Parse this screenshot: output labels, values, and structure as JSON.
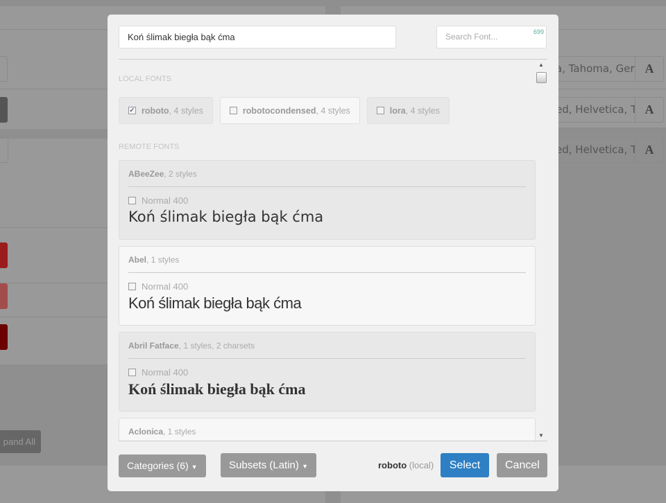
{
  "background": {
    "font_fields": [
      "a, Tahoma, Ger",
      "ed, Helvetica, Ta",
      "ed, Helvetica, Ta"
    ],
    "expand_all_label": "pand All",
    "swatch_colors": [
      "#9b1c1c",
      "#a24c4c",
      "#6a0000"
    ]
  },
  "modal": {
    "preview_text": "Koń ślimak biegła bąk ćma",
    "search_placeholder": "Search Font...",
    "font_count": "699",
    "local_heading": "LOCAL FONTS",
    "remote_heading": "REMOTE FONTS",
    "local_fonts": [
      {
        "name": "roboto",
        "styles": ", 4 styles",
        "checked": true
      },
      {
        "name": "robotocondensed",
        "styles": ", 4 styles",
        "checked": false
      },
      {
        "name": "lora",
        "styles": ", 4 styles",
        "checked": false
      }
    ],
    "remote_fonts": [
      {
        "name": "ABeeZee",
        "meta": ", 2 styles",
        "style": "Normal 400",
        "preview": "Koń ślimak biegła bąk ćma"
      },
      {
        "name": "Abel",
        "meta": ", 1 styles",
        "style": "Normal 400",
        "preview": "Koń ślimak biegła bąk ćma"
      },
      {
        "name": "Abril Fatface",
        "meta": ", 1 styles, 2 charsets",
        "style": "Normal 400",
        "preview": "Koń ślimak biegła bąk ćma"
      },
      {
        "name": "Aclonica",
        "meta": ", 1 styles"
      }
    ],
    "footer": {
      "categories_label": "Categories (6)",
      "subsets_label": "Subsets (Latin)",
      "current_font": "roboto",
      "current_source": "(local)",
      "select_label": "Select",
      "cancel_label": "Cancel",
      "select_color": "#2e7fc4"
    }
  }
}
